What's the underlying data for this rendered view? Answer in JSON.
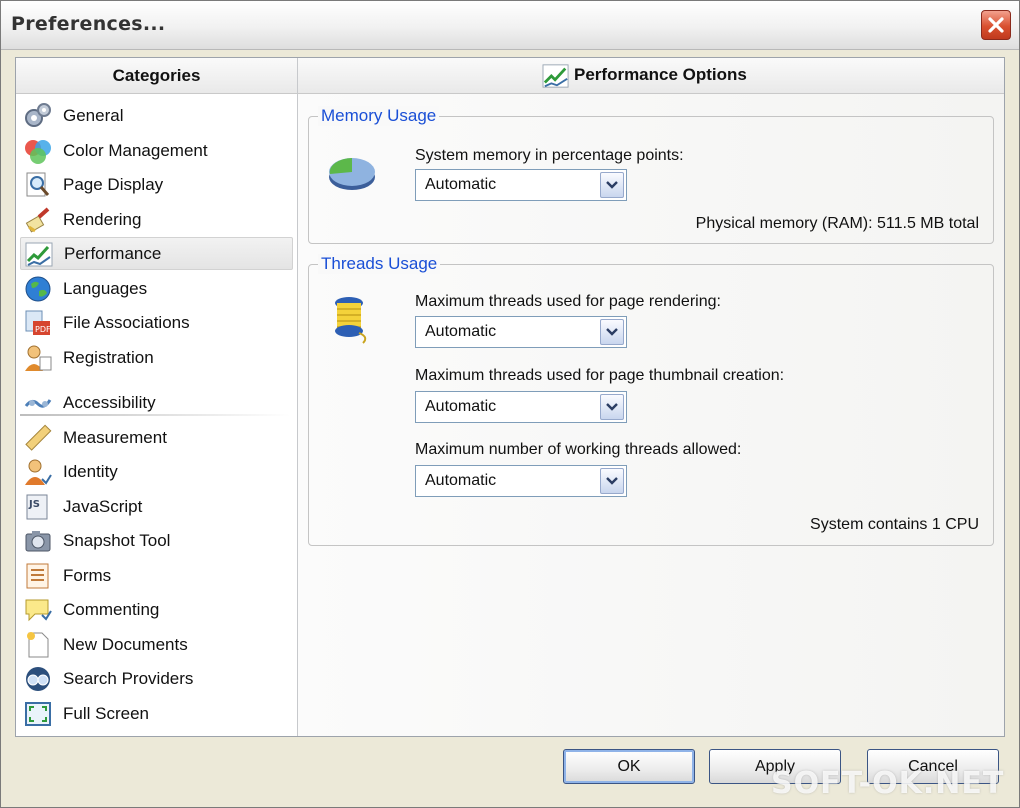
{
  "window": {
    "title": "Preferences..."
  },
  "sidebar": {
    "header": "Categories",
    "items": [
      {
        "label": "General",
        "icon": "gears-icon",
        "selected": false
      },
      {
        "label": "Color Management",
        "icon": "color-circles-icon",
        "selected": false
      },
      {
        "label": "Page Display",
        "icon": "magnifier-page-icon",
        "selected": false
      },
      {
        "label": "Rendering",
        "icon": "brush-icon",
        "selected": false
      },
      {
        "label": "Performance",
        "icon": "performance-chart-icon",
        "selected": true
      },
      {
        "label": "Languages",
        "icon": "globe-icon",
        "selected": false
      },
      {
        "label": "File Associations",
        "icon": "file-association-icon",
        "selected": false
      },
      {
        "label": "Registration",
        "icon": "registration-icon",
        "selected": false
      },
      {
        "label": "Accessibility",
        "icon": "accessibility-icon",
        "selected": false
      },
      {
        "label": "Measurement",
        "icon": "ruler-icon",
        "selected": false
      },
      {
        "label": "Identity",
        "icon": "person-icon",
        "selected": false
      },
      {
        "label": "JavaScript",
        "icon": "javascript-icon",
        "selected": false
      },
      {
        "label": "Snapshot Tool",
        "icon": "camera-icon",
        "selected": false
      },
      {
        "label": "Forms",
        "icon": "form-icon",
        "selected": false
      },
      {
        "label": "Commenting",
        "icon": "comment-icon",
        "selected": false
      },
      {
        "label": "New Documents",
        "icon": "new-document-icon",
        "selected": false
      },
      {
        "label": "Search Providers",
        "icon": "search-binoculars-icon",
        "selected": false
      },
      {
        "label": "Full Screen",
        "icon": "fullscreen-icon",
        "selected": false
      }
    ]
  },
  "panel": {
    "title": "Performance Options",
    "memory": {
      "legend": "Memory Usage",
      "label": "System memory in percentage points:",
      "value": "Automatic",
      "info": "Physical memory (RAM): 511.5 MB total"
    },
    "threads": {
      "legend": "Threads Usage",
      "rendering_label": "Maximum threads used for page rendering:",
      "rendering_value": "Automatic",
      "thumbnail_label": "Maximum threads used for page thumbnail creation:",
      "thumbnail_value": "Automatic",
      "working_label": "Maximum number of working threads allowed:",
      "working_value": "Automatic",
      "info": "System contains 1 CPU"
    }
  },
  "buttons": {
    "ok": "OK",
    "apply": "Apply",
    "cancel": "Cancel"
  },
  "watermark": "SOFT-OK.NET",
  "colors": {
    "legend": "#1a4fd6",
    "close": "#d9502f",
    "accent": "#3b5584"
  }
}
